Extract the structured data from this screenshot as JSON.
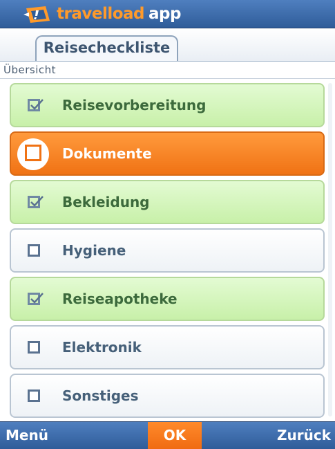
{
  "header": {
    "brand_part1": "travelload",
    "brand_part2": "app"
  },
  "tabs": [
    {
      "label": "Reisecheckliste",
      "active": true
    }
  ],
  "section_label": "Übersicht",
  "checklist": {
    "items": [
      {
        "label": "Reisevorbereitung",
        "checked": true
      },
      {
        "label": "Dokumente",
        "checked": false,
        "selected": true
      },
      {
        "label": "Bekleidung",
        "checked": true
      },
      {
        "label": "Hygiene",
        "checked": false
      },
      {
        "label": "Reiseapotheke",
        "checked": true
      },
      {
        "label": "Elektronik",
        "checked": false
      },
      {
        "label": "Sonstiges",
        "checked": false
      }
    ]
  },
  "softkeys": {
    "left": "Menü",
    "center": "OK",
    "right": "Zurück"
  },
  "colors": {
    "header_blue": "#3a6aa9",
    "accent_orange": "#f07214",
    "done_green": "#c8f0a9"
  }
}
